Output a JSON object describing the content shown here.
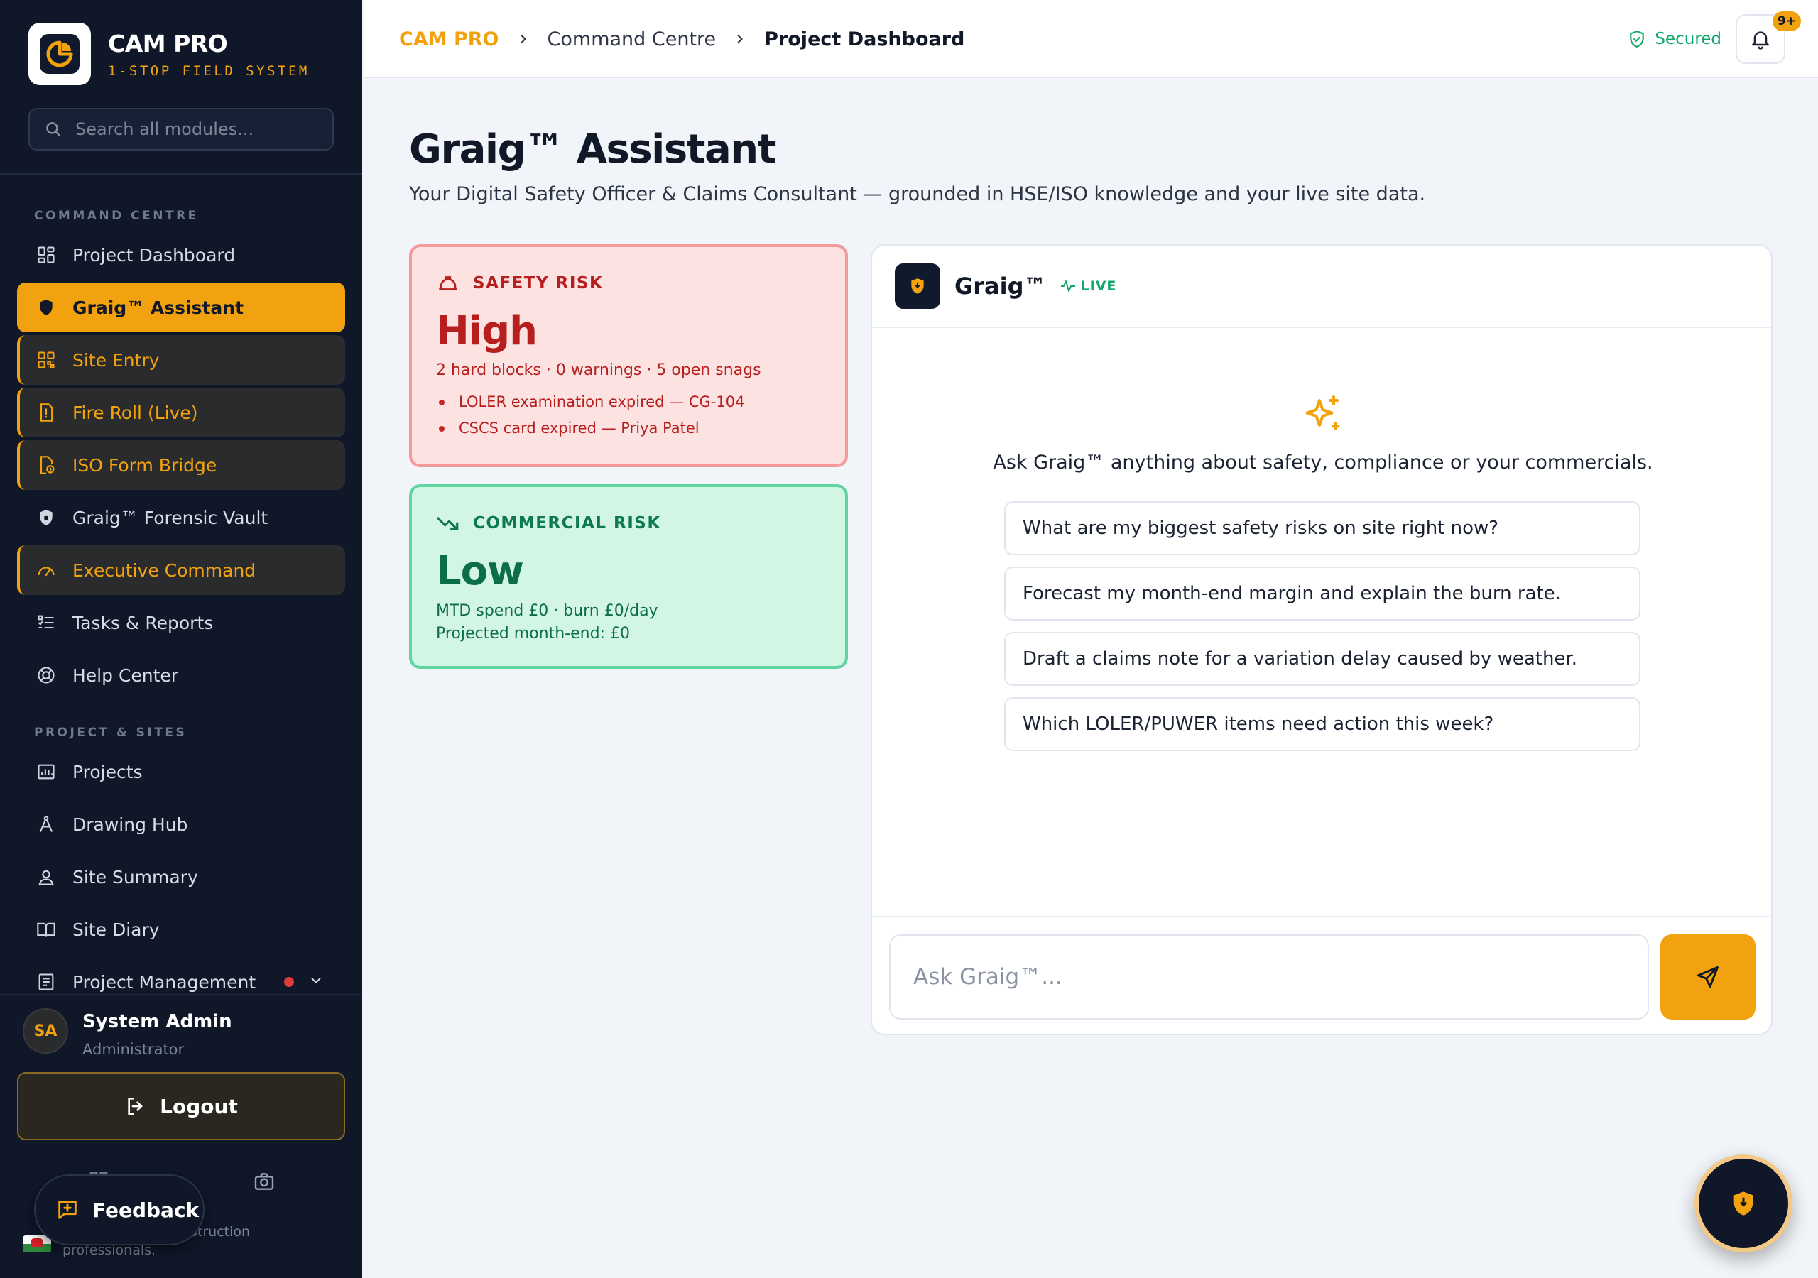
{
  "brand": {
    "name": "CAM PRO",
    "tagline": "1-STOP FIELD SYSTEM"
  },
  "search": {
    "placeholder": "Search all modules..."
  },
  "nav": {
    "section1": "COMMAND CENTRE",
    "section2": "PROJECT & SITES",
    "items": [
      {
        "label": "Project Dashboard",
        "icon": "dashboard-grid-icon"
      },
      {
        "label": "Graig™ Assistant",
        "icon": "shield-icon"
      },
      {
        "label": "Site Entry",
        "icon": "qr-code-icon"
      },
      {
        "label": "Fire Roll (Live)",
        "icon": "alert-document-icon"
      },
      {
        "label": "ISO Form Bridge",
        "icon": "file-sync-icon"
      },
      {
        "label": "Graig™ Forensic Vault",
        "icon": "shield-lock-icon"
      },
      {
        "label": "Executive Command",
        "icon": "gauge-icon"
      },
      {
        "label": "Tasks & Reports",
        "icon": "checklist-icon"
      },
      {
        "label": "Help Center",
        "icon": "lifebuoy-icon"
      }
    ],
    "items2": [
      {
        "label": "Projects",
        "icon": "projects-chart-icon"
      },
      {
        "label": "Drawing Hub",
        "icon": "compass-icon"
      },
      {
        "label": "Site Summary",
        "icon": "location-user-icon"
      },
      {
        "label": "Site Diary",
        "icon": "book-open-icon"
      },
      {
        "label": "Project Management",
        "icon": "document-list-icon"
      }
    ]
  },
  "user": {
    "initials": "SA",
    "name": "System Admin",
    "role": "Administrator"
  },
  "logout_label": "Logout",
  "feedback_label": "Feedback",
  "sidebar_footer": {
    "text": "struction professionals."
  },
  "breadcrumb": {
    "root": "CAM PRO",
    "middle": "Command Centre",
    "current": "Project Dashboard"
  },
  "status": {
    "secured": "Secured",
    "notifications": "9+"
  },
  "page": {
    "title": "Graig™ Assistant",
    "subtitle": "Your Digital Safety Officer & Claims Consultant — grounded in HSE/ISO knowledge and your live site data."
  },
  "safety_risk": {
    "label": "SAFETY RISK",
    "level": "High",
    "summary": "2 hard blocks · 0 warnings · 5 open snags",
    "items": [
      "LOLER examination expired — CG-104",
      "CSCS card expired — Priya Patel"
    ]
  },
  "commercial_risk": {
    "label": "COMMERCIAL RISK",
    "level": "Low",
    "line1": "MTD spend £0 · burn £0/day",
    "line2": "Projected month-end: £0"
  },
  "chat": {
    "name": "Graig™",
    "live": "LIVE",
    "prompt": "Ask Graig™ anything about safety, compliance or your commercials.",
    "suggestions": [
      "What are my biggest safety risks on site right now?",
      "Forecast my month-end margin and explain the burn rate.",
      "Draft a claims note for a variation delay caused by weather.",
      "Which LOLER/PUWER items need action this week?"
    ],
    "input_placeholder": "Ask Graig™..."
  },
  "colors": {
    "accent": "#f3a20f",
    "sidebar": "#0f1729",
    "danger": "#b71f1f",
    "success": "#0b6e47"
  }
}
